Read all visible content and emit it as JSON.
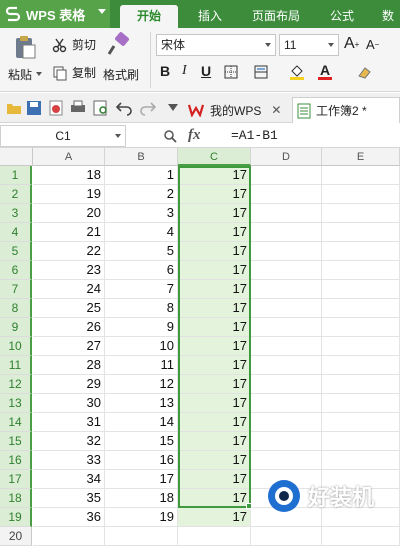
{
  "app": {
    "name": "WPS 表格"
  },
  "ribbon_tabs": [
    "开始",
    "插入",
    "页面布局",
    "公式",
    "数"
  ],
  "ribbon": {
    "paste_label": "粘贴",
    "cut_label": "剪切",
    "copy_label": "复制",
    "format_painter_label": "格式刷",
    "font_name": "宋体",
    "font_size": "11",
    "bold": "B",
    "italic": "I",
    "underline": "U",
    "grow_font": "A",
    "shrink_font": "A"
  },
  "doc_tabs": [
    {
      "label": "我的WPS"
    },
    {
      "label": "工作簿2 *"
    }
  ],
  "formula_bar": {
    "cell_ref": "C1",
    "fx": "fx",
    "formula": "=A1-B1"
  },
  "columns": [
    "A",
    "B",
    "C",
    "D",
    "E"
  ],
  "row_numbers": [
    "1",
    "2",
    "3",
    "4",
    "5",
    "6",
    "7",
    "8",
    "9",
    "10",
    "11",
    "12",
    "13",
    "14",
    "15",
    "16",
    "17",
    "18",
    "19",
    "20"
  ],
  "rows": [
    [
      "18",
      "1",
      "17"
    ],
    [
      "19",
      "2",
      "17"
    ],
    [
      "20",
      "3",
      "17"
    ],
    [
      "21",
      "4",
      "17"
    ],
    [
      "22",
      "5",
      "17"
    ],
    [
      "23",
      "6",
      "17"
    ],
    [
      "24",
      "7",
      "17"
    ],
    [
      "25",
      "8",
      "17"
    ],
    [
      "26",
      "9",
      "17"
    ],
    [
      "27",
      "10",
      "17"
    ],
    [
      "28",
      "11",
      "17"
    ],
    [
      "29",
      "12",
      "17"
    ],
    [
      "30",
      "13",
      "17"
    ],
    [
      "31",
      "14",
      "17"
    ],
    [
      "32",
      "15",
      "17"
    ],
    [
      "33",
      "16",
      "17"
    ],
    [
      "34",
      "17",
      "17"
    ],
    [
      "35",
      "18",
      "17"
    ],
    [
      "36",
      "19",
      "17"
    ]
  ],
  "colors": {
    "accent": "#3c8c3c",
    "selection": "#e3f3dc",
    "selection_border": "#3f9a3f"
  },
  "watermark": "好装机"
}
